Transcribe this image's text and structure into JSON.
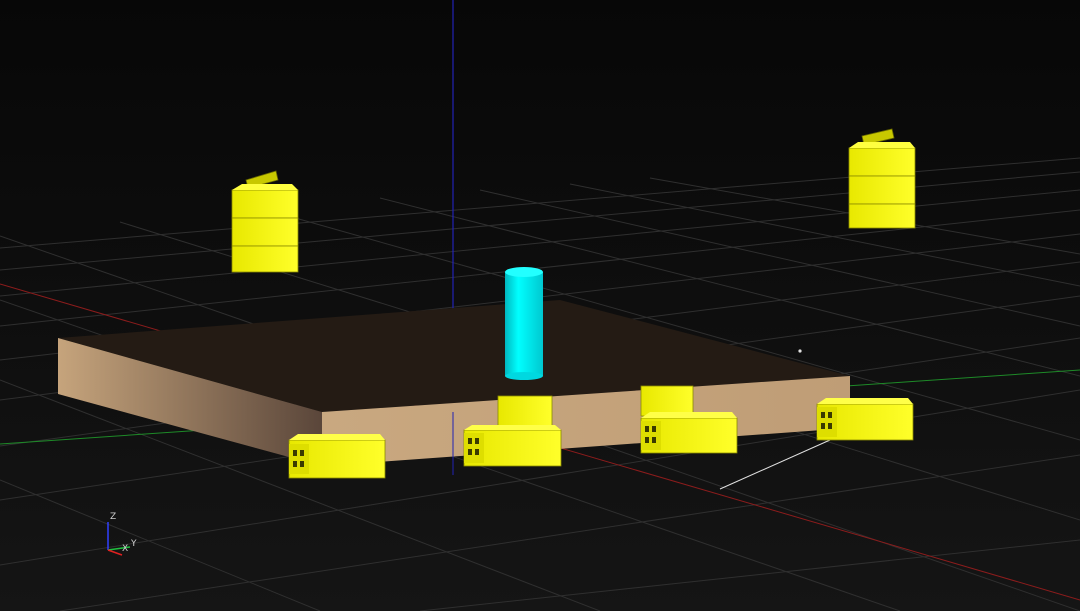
{
  "viewport": {
    "background_top": "#070707",
    "background_bottom": "#141414"
  },
  "axes_indicator": {
    "z_label": "Z",
    "x_label": "X",
    "y_label": "Y",
    "colors": {
      "x": "#e02020",
      "y": "#20c040",
      "z": "#3040ff",
      "label": "#d0d0d0"
    }
  },
  "scene": {
    "grid_color": "#3a3a3a",
    "x_axis_color": "#9a1a1a",
    "y_axis_color": "#1f9a2a",
    "z_axis_color": "#2424b8",
    "slab_top_color": "#231a13",
    "slab_front_color": "#c4a27c",
    "slab_side_color": "#6a5442",
    "block_color": "#f2f20a",
    "block_dark_color": "#c9c900",
    "cylinder_color": "#00f0f0"
  }
}
